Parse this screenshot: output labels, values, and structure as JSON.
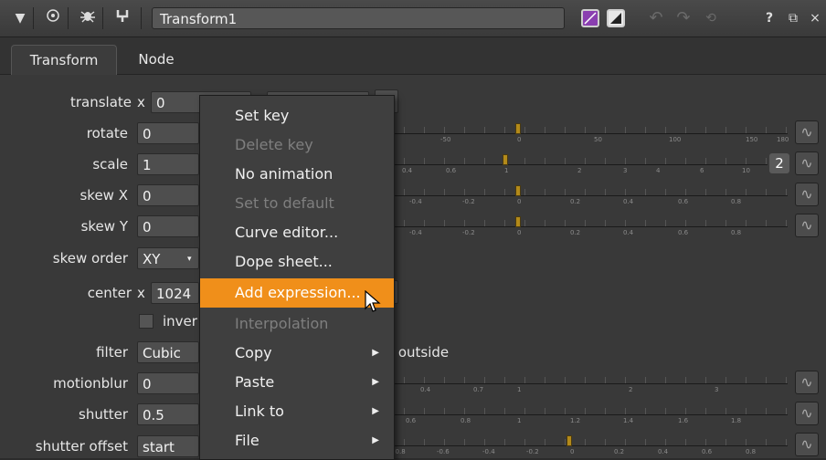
{
  "window": {
    "node_name": "Transform1",
    "icons": [
      "collapse-triangle-icon",
      "target-icon",
      "bug-icon",
      "pin-icon"
    ],
    "right_icons": [
      "purple-swatch-icon",
      "white-swatch-icon",
      "undo-icon",
      "redo-icon",
      "revert-icon",
      "help-icon",
      "float-icon",
      "close-icon"
    ],
    "help_glyph": "?",
    "close_glyph": "×"
  },
  "tabs": [
    {
      "label": "Transform",
      "active": true
    },
    {
      "label": "Node",
      "active": false
    }
  ],
  "knobs": {
    "translate": {
      "label": "translate",
      "axis": "x",
      "value": "0"
    },
    "rotate": {
      "label": "rotate",
      "value": "0"
    },
    "scale": {
      "label": "scale",
      "value": "1",
      "badge": "2"
    },
    "skew_x": {
      "label": "skew X",
      "value": "0"
    },
    "skew_y": {
      "label": "skew Y",
      "value": "0"
    },
    "skew_order": {
      "label": "skew order",
      "value": "XY"
    },
    "center": {
      "label": "center",
      "axis": "x",
      "value": "1024"
    },
    "invert": {
      "label": "inver"
    },
    "filter": {
      "label": "filter",
      "value": "Cubic",
      "suffix": "outside"
    },
    "motionblur": {
      "label": "motionblur",
      "value": "0"
    },
    "shutter": {
      "label": "shutter",
      "value": "0.5"
    },
    "shutter_offset": {
      "label": "shutter offset",
      "value": "start"
    }
  },
  "slider_ticks": {
    "rotate": [
      "-50",
      "0",
      "50",
      "100",
      "150",
      "180"
    ],
    "scale": [
      "0.4",
      "0.6",
      "1",
      "2",
      "3",
      "4",
      "6",
      "10"
    ],
    "skew_x": [
      "-0.4",
      "-0.2",
      "0",
      "0.2",
      "0.4",
      "0.6",
      "0.8"
    ],
    "skew_y": [
      "-0.4",
      "-0.2",
      "0",
      "0.2",
      "0.4",
      "0.6",
      "0.8"
    ],
    "motionblur": [
      "0.4",
      "0.7",
      "1",
      "2",
      "3"
    ],
    "shutter": [
      "0.6",
      "0.8",
      "1",
      "1.2",
      "1.4",
      "1.6",
      "1.8"
    ],
    "shutter_offset": [
      "-0.8",
      "-0.6",
      "-0.4",
      "-0.2",
      "0",
      "0.2",
      "0.4",
      "0.6",
      "0.8"
    ]
  },
  "context_menu": {
    "items": [
      {
        "label": "Set key",
        "disabled": false
      },
      {
        "label": "Delete key",
        "disabled": true
      },
      {
        "label": "No animation",
        "disabled": false
      },
      {
        "label": "Set to default",
        "disabled": true
      },
      {
        "label": "Curve editor...",
        "disabled": false
      },
      {
        "label": "Dope sheet...",
        "disabled": false
      },
      {
        "label": "Add expression...",
        "disabled": false,
        "highlighted": true
      },
      {
        "label": "Interpolation",
        "disabled": true
      },
      {
        "label": "Copy",
        "submenu": true
      },
      {
        "label": "Paste",
        "submenu": true
      },
      {
        "label": "Link to",
        "submenu": true
      },
      {
        "label": "File",
        "submenu": true
      }
    ]
  },
  "colors": {
    "highlight": "#f08f1a",
    "handle": "#b38a1a"
  }
}
